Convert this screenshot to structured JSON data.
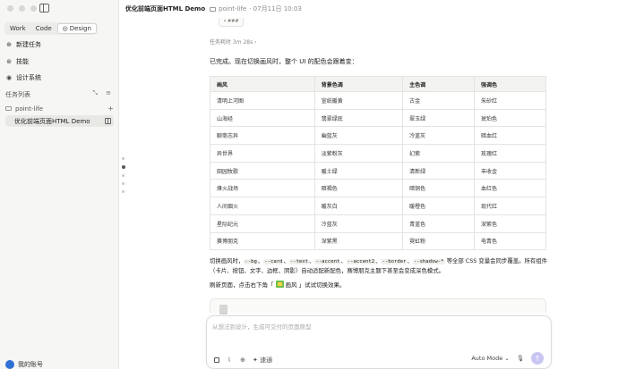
{
  "sidebar": {
    "tabs": [
      {
        "label": "Work"
      },
      {
        "label": "Code"
      },
      {
        "label": "Design"
      }
    ],
    "menu": [
      {
        "label": "新建任务",
        "icon": "plus-icon"
      },
      {
        "label": "技能",
        "icon": "skill-icon"
      },
      {
        "label": "设计系统",
        "icon": "palette-icon"
      }
    ],
    "section_title": "任务列表",
    "folder": {
      "label": "point-life"
    },
    "active_task": {
      "label": "优化前端页面HTML Demo"
    },
    "user": {
      "label": "我的账号"
    }
  },
  "header": {
    "title": "优化前端页面HTML Demo",
    "project": "point-life",
    "timestamp": "· 07月11日 10:03"
  },
  "content": {
    "top_pill": "• ###",
    "duration": "任务耗时 3m 28s",
    "intro": "已完成。现在切换画风时，整个 UI 的配色会跟着变：",
    "table": {
      "headers": [
        "画风",
        "背景色调",
        "主色调",
        "强调色"
      ],
      "rows": [
        [
          "清明上河图",
          "宣纸暖黄",
          "古金",
          "朱砂红"
        ],
        [
          "山海经",
          "翡翠绿底",
          "翠玉绿",
          "琥珀色"
        ],
        [
          "聊斋志异",
          "幽蓝灰",
          "冷蓝灰",
          "暗血红"
        ],
        [
          "异世界",
          "淡紫粉灰",
          "幻紫",
          "玫瑰红"
        ],
        [
          "田园牧歌",
          "暖土绿",
          "清新绿",
          "丰收金"
        ],
        [
          "烽火战场",
          "暗褐色",
          "暗铜色",
          "血红色"
        ],
        [
          "人间烟火",
          "暖灰白",
          "暖橙色",
          "现代红"
        ],
        [
          "星际纪元",
          "冷蓝灰",
          "青蓝色",
          "深紫色"
        ],
        [
          "赛博朋克",
          "深紫黑",
          "霓虹粉",
          "电青色"
        ]
      ]
    },
    "para2_before": "切换画风时，",
    "codes": [
      "--bg",
      "--card",
      "--text",
      "--accent",
      "--accent2",
      "--border",
      "--shadow-*"
    ],
    "para2_after": "等全部 CSS 变量会同步覆盖。所有组件（卡片、按钮、文字、边框、阴影）自动适配新配色，赛博朋克主题下甚至会变成深色模式。",
    "para3_before": "刷新页面，点击右下角「",
    "para3_icon": "画风",
    "para3_after": "」试试切换效果。"
  },
  "composer": {
    "placeholder": "从想法到设计，生成可交付的页面原型",
    "model_label": "速通",
    "mode_label": "Auto Mode"
  }
}
